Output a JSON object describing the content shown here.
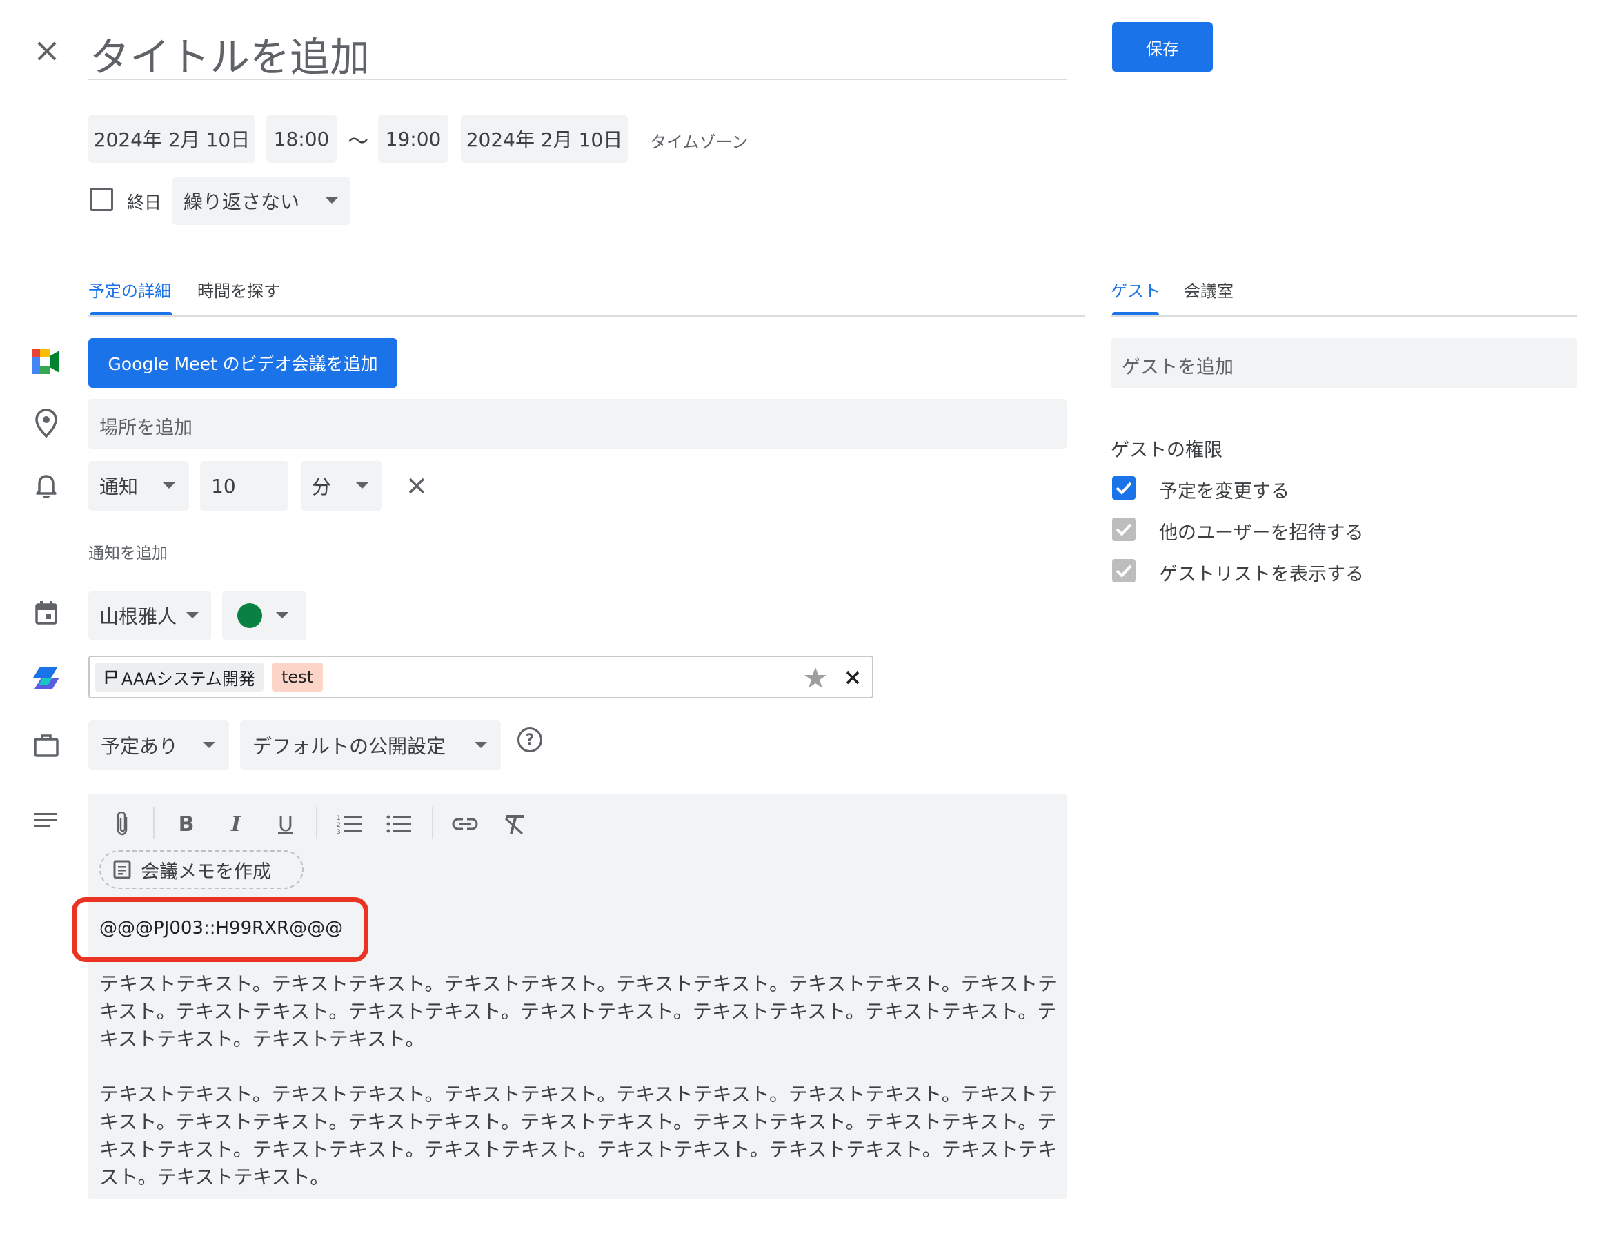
{
  "header": {
    "title_placeholder": "タイトルを追加",
    "save_label": "保存"
  },
  "datetime": {
    "start_date": "2024年 2月 10日",
    "start_time": "18:00",
    "separator": "〜",
    "end_time": "19:00",
    "end_date": "2024年 2月 10日",
    "timezone_link": "タイムゾーン",
    "all_day_label": "終日",
    "all_day_checked": false,
    "repeat_value": "繰り返さない"
  },
  "tabs_left": [
    {
      "label": "予定の詳細",
      "active": true
    },
    {
      "label": "時間を探す",
      "active": false
    }
  ],
  "tabs_right": [
    {
      "label": "ゲスト",
      "active": true
    },
    {
      "label": "会議室",
      "active": false
    }
  ],
  "meet": {
    "button_label": "Google Meet のビデオ会議を追加"
  },
  "location": {
    "placeholder": "場所を追加"
  },
  "notification": {
    "type": "通知",
    "amount": "10",
    "unit": "分",
    "add_label": "通知を追加"
  },
  "calendar": {
    "owner": "山根雅人",
    "color": "#0b8043"
  },
  "tags": {
    "project_tag": "AAAシステム開発",
    "test_tag": "test"
  },
  "availability": {
    "status": "予定あり",
    "visibility": "デフォルトの公開設定"
  },
  "editor": {
    "meeting_notes_label": "会議メモを作成",
    "code_line": "@@@PJ003::H99RXR@@@",
    "paragraph1": "テキストテキスト。テキストテキスト。テキストテキスト。テキストテキスト。テキストテキスト。テキストテキスト。テキストテキスト。テキストテキスト。テキストテキスト。テキストテキスト。テキストテキスト。テキストテキスト。テキストテキスト。",
    "paragraph2": "テキストテキスト。テキストテキスト。テキストテキスト。テキストテキスト。テキストテキスト。テキストテキスト。テキストテキスト。テキストテキスト。テキストテキスト。テキストテキスト。テキストテキスト。テキストテキスト。テキストテキスト。テキストテキスト。テキストテキスト。テキストテキスト。テキストテキスト。テキストテキスト。"
  },
  "guests": {
    "add_placeholder": "ゲストを追加",
    "permissions_title": "ゲストの権限",
    "permissions": [
      {
        "label": "予定を変更する",
        "checked": true,
        "enabled": true
      },
      {
        "label": "他のユーザーを招待する",
        "checked": true,
        "enabled": false
      },
      {
        "label": "ゲストリストを表示する",
        "checked": true,
        "enabled": false
      }
    ]
  },
  "colors": {
    "primary": "#1a73e8",
    "highlight_box": "#ea3323",
    "field_bg": "#f1f3f4",
    "test_tag_bg": "#fcd5c8"
  }
}
